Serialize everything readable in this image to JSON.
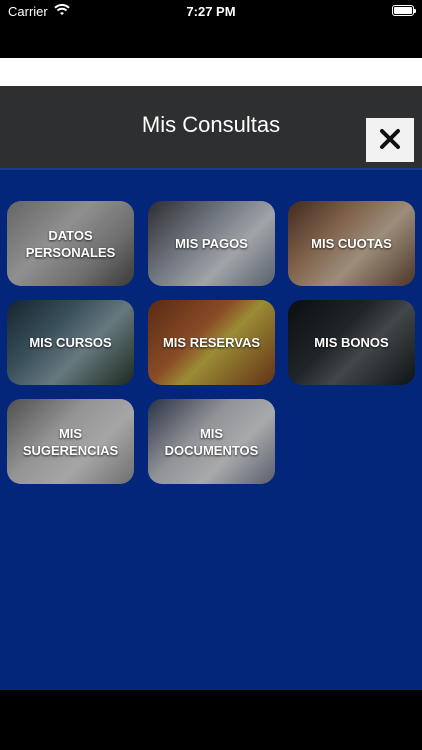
{
  "status_bar": {
    "carrier": "Carrier",
    "time": "7:27 PM",
    "icons": [
      "wifi-icon",
      "battery-icon"
    ]
  },
  "header": {
    "title": "Mis Consultas",
    "close_icon": "close-icon"
  },
  "menu": {
    "tiles": [
      {
        "label": "DATOS PERSONALES"
      },
      {
        "label": "MIS PAGOS"
      },
      {
        "label": "MIS CUOTAS"
      },
      {
        "label": "MIS CURSOS"
      },
      {
        "label": "MIS RESERVAS"
      },
      {
        "label": "MIS BONOS"
      },
      {
        "label": "MIS SUGERENCIAS"
      },
      {
        "label": "MIS DOCUMENTOS"
      }
    ]
  },
  "colors": {
    "header_bg": "#2d2f31",
    "main_bg": "#03257a",
    "close_bg": "#f2f2f2"
  }
}
